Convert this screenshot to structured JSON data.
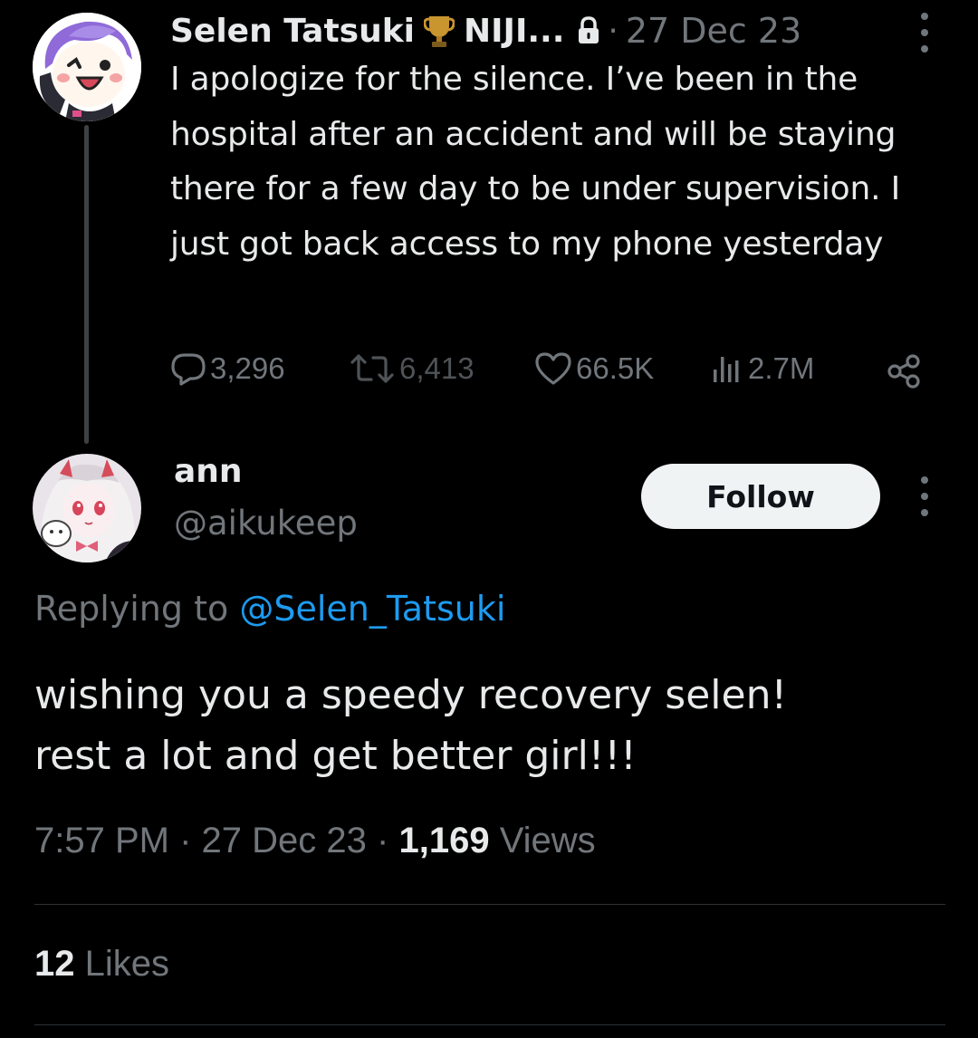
{
  "parent_tweet": {
    "display_name": "Selen Tatsuki",
    "name_suffix": "NIJI...",
    "separator": "·",
    "date": "27 Dec 23",
    "text": "I apologize for the silence. I’ve been in the hospital after an accident and will be staying there for a few day to be under supervision. I just got back access to my phone yesterday",
    "badge_icon": "trophy-icon",
    "lock_icon": "lock-icon",
    "actions": {
      "replies": "3,296",
      "reposts": "6,413",
      "likes": "66.5K",
      "views": "2.7M"
    }
  },
  "reply_tweet": {
    "display_name": "ann",
    "handle": "@aikukeep",
    "follow_label": "Follow",
    "replying_to_label": "Replying to",
    "replying_to_handle": "@Selen_Tatsuki",
    "text_line_1": "wishing you a speedy recovery selen!",
    "text_line_2": "rest a lot and get better girl!!!",
    "time": "7:57 PM",
    "separator": "·",
    "date": "27 Dec 23",
    "views_count": "1,169",
    "views_label": "Views",
    "likes_count": "12",
    "likes_label": "Likes"
  },
  "colors": {
    "background": "#000000",
    "primary_text": "#e7e9ea",
    "secondary_text": "#71767b",
    "link": "#1d9bf0",
    "follow_button_bg": "#eff3f4",
    "divider": "#2f3336"
  }
}
